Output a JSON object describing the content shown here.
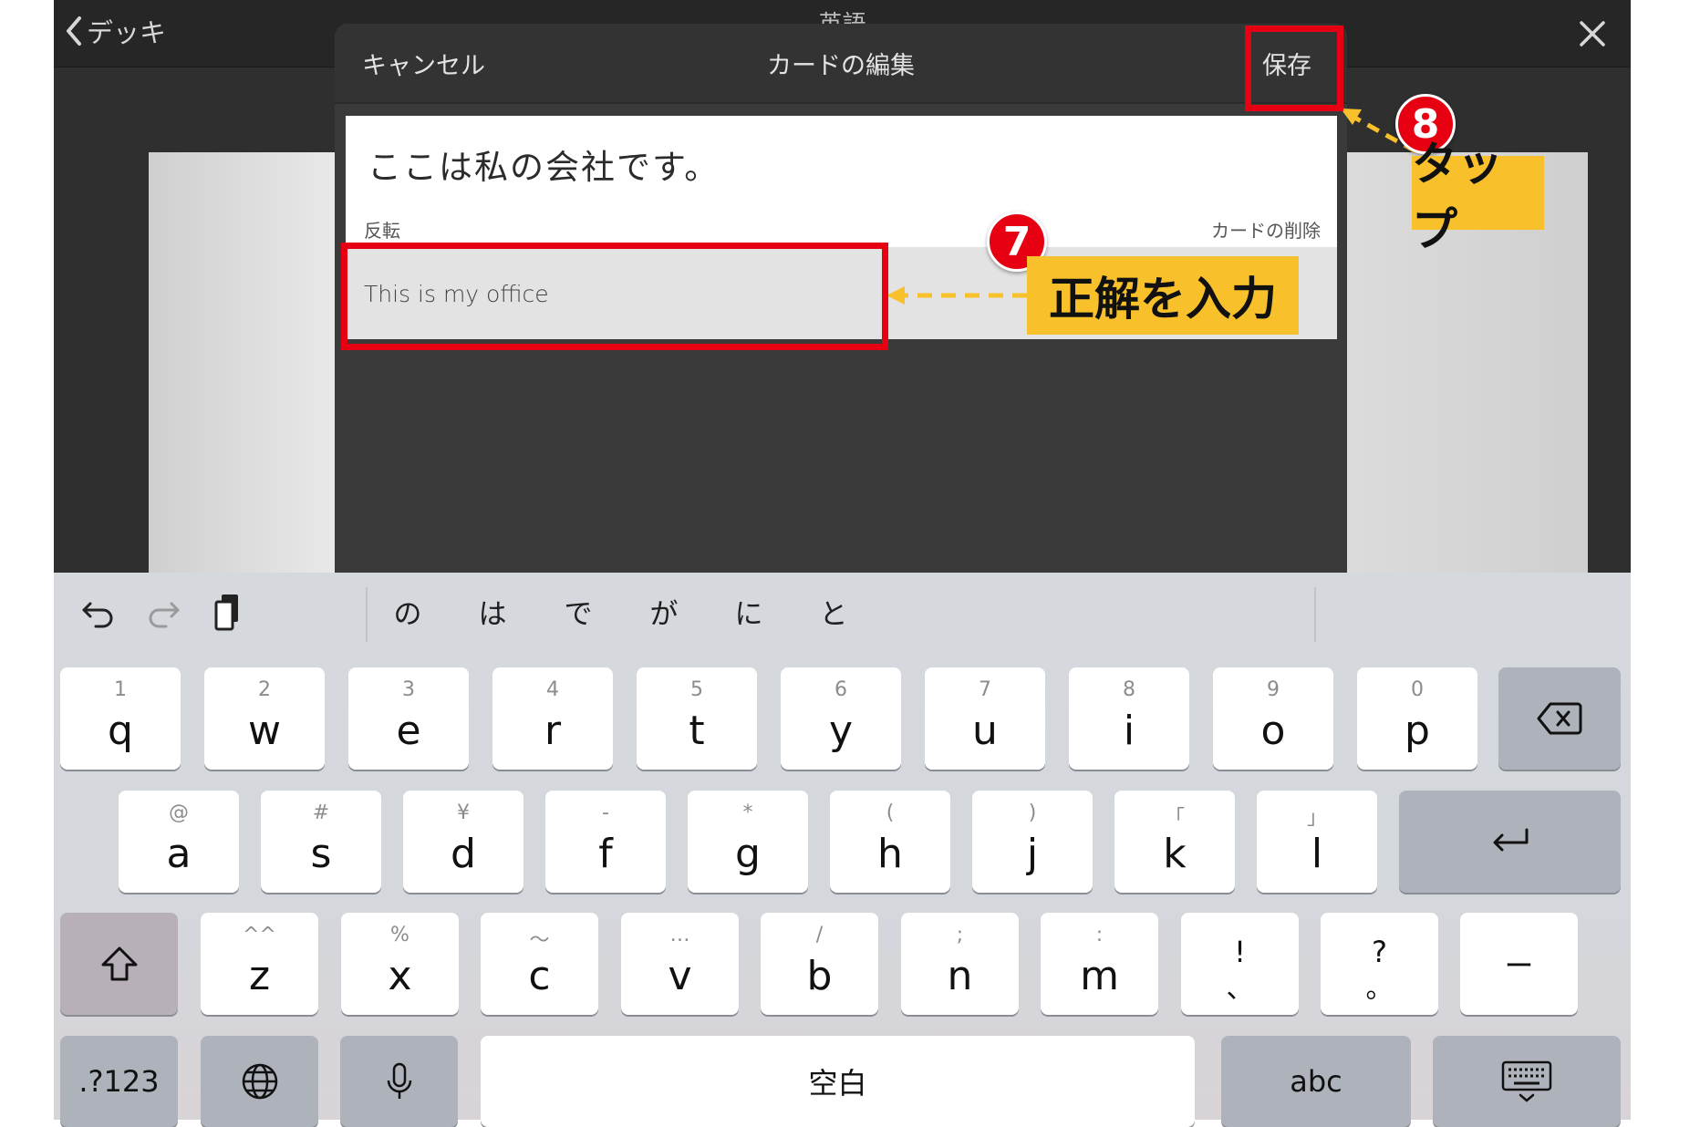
{
  "nav": {
    "back_label": "デッキ",
    "title": "英語"
  },
  "modal": {
    "cancel_label": "キャンセル",
    "title": "カードの編集",
    "save_label": "保存",
    "front_text": "ここは私の会社です。",
    "flip_label": "反転",
    "delete_label": "カードの削除",
    "back_value": "This is my office"
  },
  "annotations": {
    "step7_number": "7",
    "step7_text": "正解を入力",
    "step8_number": "8",
    "step8_text": "タップ",
    "highlight_color": "#e60012",
    "callout_color": "#f8c02a"
  },
  "keyboard": {
    "candidates": [
      "の",
      "は",
      "で",
      "が",
      "に",
      "と"
    ],
    "row1": [
      {
        "main": "q",
        "sub": "1"
      },
      {
        "main": "w",
        "sub": "2"
      },
      {
        "main": "e",
        "sub": "3"
      },
      {
        "main": "r",
        "sub": "4"
      },
      {
        "main": "t",
        "sub": "5"
      },
      {
        "main": "y",
        "sub": "6"
      },
      {
        "main": "u",
        "sub": "7"
      },
      {
        "main": "i",
        "sub": "8"
      },
      {
        "main": "o",
        "sub": "9"
      },
      {
        "main": "p",
        "sub": "0"
      }
    ],
    "row2": [
      {
        "main": "a",
        "sub": "@"
      },
      {
        "main": "s",
        "sub": "#"
      },
      {
        "main": "d",
        "sub": "¥"
      },
      {
        "main": "f",
        "sub": "-"
      },
      {
        "main": "g",
        "sub": "*"
      },
      {
        "main": "h",
        "sub": "("
      },
      {
        "main": "j",
        "sub": ")"
      },
      {
        "main": "k",
        "sub": "「"
      },
      {
        "main": "l",
        "sub": "」"
      }
    ],
    "row3": [
      {
        "main": "z",
        "sub": "^^"
      },
      {
        "main": "x",
        "sub": "%"
      },
      {
        "main": "c",
        "sub": "〜"
      },
      {
        "main": "v",
        "sub": "…"
      },
      {
        "main": "b",
        "sub": "/"
      },
      {
        "main": "n",
        "sub": ";"
      },
      {
        "main": "m",
        "sub": ":"
      }
    ],
    "punct1": {
      "top": "!",
      "bottom": "、"
    },
    "punct2": {
      "top": "?",
      "bottom": "。"
    },
    "dash_label": "ー",
    "numbers_label": ".?123",
    "space_label": "空白",
    "abc_label": "abc"
  }
}
